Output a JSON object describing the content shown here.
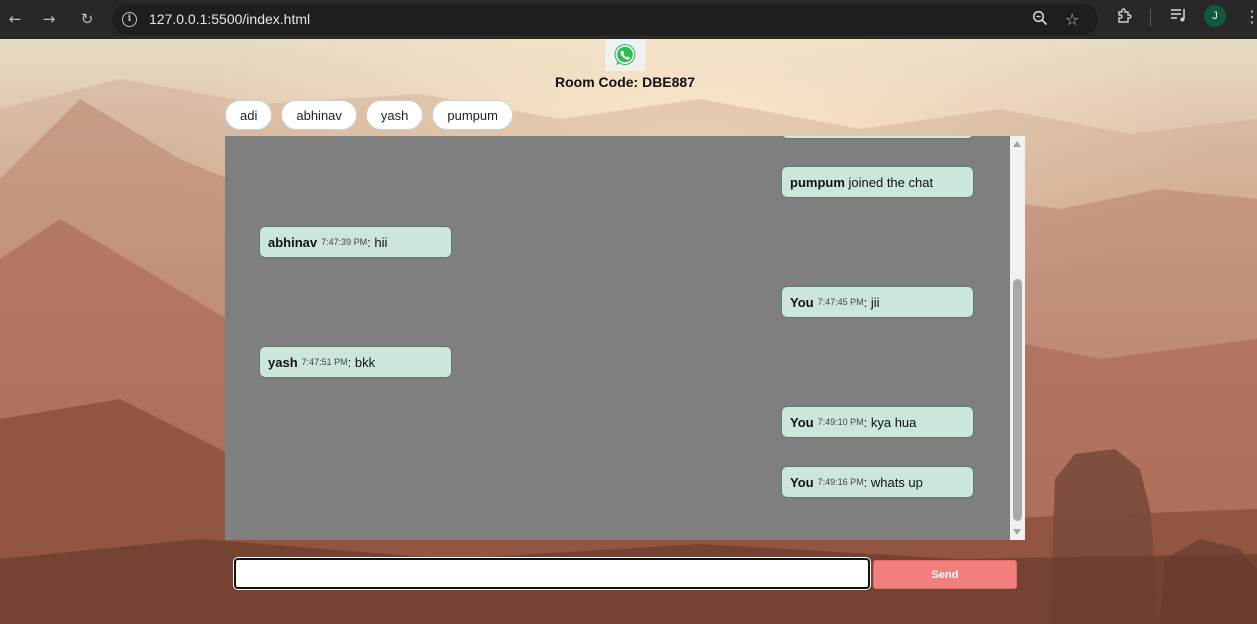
{
  "browser": {
    "url": "127.0.0.1:5500/index.html",
    "profile_initial": "J"
  },
  "room": {
    "label": "Room Code: DBE887"
  },
  "users": [
    "adi",
    "abhinav",
    "yash",
    "pumpum"
  ],
  "messages": [
    {
      "side": "right",
      "sender": "pumpum",
      "time": "",
      "text": "joined the chat"
    },
    {
      "side": "left",
      "sender": "abhinav",
      "time": "7:47:39 PM",
      "text": ": hii"
    },
    {
      "side": "right",
      "sender": "You",
      "time": "7:47:45 PM",
      "text": ": jii"
    },
    {
      "side": "left",
      "sender": "yash",
      "time": "7:47:51 PM",
      "text": ": bkk"
    },
    {
      "side": "right",
      "sender": "You",
      "time": "7:49:10 PM",
      "text": ": kya hua"
    },
    {
      "side": "right",
      "sender": "You",
      "time": "7:49:16 PM",
      "text": ": whats up"
    }
  ],
  "composer": {
    "value": "",
    "send_label": "Send"
  },
  "colors": {
    "chat_bg": "#7f7f7f",
    "bubble": "#cce6da",
    "send_button": "#f07f7d"
  }
}
